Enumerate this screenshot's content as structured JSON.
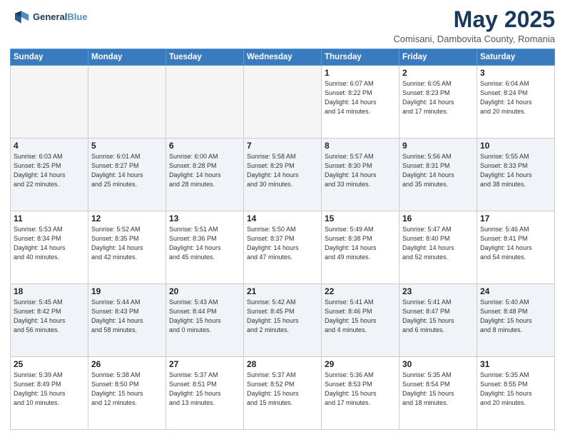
{
  "header": {
    "logo_line1": "General",
    "logo_line2": "Blue",
    "month": "May 2025",
    "location": "Comisani, Dambovita County, Romania"
  },
  "weekdays": [
    "Sunday",
    "Monday",
    "Tuesday",
    "Wednesday",
    "Thursday",
    "Friday",
    "Saturday"
  ],
  "weeks": [
    [
      {
        "day": "",
        "info": ""
      },
      {
        "day": "",
        "info": ""
      },
      {
        "day": "",
        "info": ""
      },
      {
        "day": "",
        "info": ""
      },
      {
        "day": "1",
        "info": "Sunrise: 6:07 AM\nSunset: 8:22 PM\nDaylight: 14 hours\nand 14 minutes."
      },
      {
        "day": "2",
        "info": "Sunrise: 6:05 AM\nSunset: 8:23 PM\nDaylight: 14 hours\nand 17 minutes."
      },
      {
        "day": "3",
        "info": "Sunrise: 6:04 AM\nSunset: 8:24 PM\nDaylight: 14 hours\nand 20 minutes."
      }
    ],
    [
      {
        "day": "4",
        "info": "Sunrise: 6:03 AM\nSunset: 8:25 PM\nDaylight: 14 hours\nand 22 minutes."
      },
      {
        "day": "5",
        "info": "Sunrise: 6:01 AM\nSunset: 8:27 PM\nDaylight: 14 hours\nand 25 minutes."
      },
      {
        "day": "6",
        "info": "Sunrise: 6:00 AM\nSunset: 8:28 PM\nDaylight: 14 hours\nand 28 minutes."
      },
      {
        "day": "7",
        "info": "Sunrise: 5:58 AM\nSunset: 8:29 PM\nDaylight: 14 hours\nand 30 minutes."
      },
      {
        "day": "8",
        "info": "Sunrise: 5:57 AM\nSunset: 8:30 PM\nDaylight: 14 hours\nand 33 minutes."
      },
      {
        "day": "9",
        "info": "Sunrise: 5:56 AM\nSunset: 8:31 PM\nDaylight: 14 hours\nand 35 minutes."
      },
      {
        "day": "10",
        "info": "Sunrise: 5:55 AM\nSunset: 8:33 PM\nDaylight: 14 hours\nand 38 minutes."
      }
    ],
    [
      {
        "day": "11",
        "info": "Sunrise: 5:53 AM\nSunset: 8:34 PM\nDaylight: 14 hours\nand 40 minutes."
      },
      {
        "day": "12",
        "info": "Sunrise: 5:52 AM\nSunset: 8:35 PM\nDaylight: 14 hours\nand 42 minutes."
      },
      {
        "day": "13",
        "info": "Sunrise: 5:51 AM\nSunset: 8:36 PM\nDaylight: 14 hours\nand 45 minutes."
      },
      {
        "day": "14",
        "info": "Sunrise: 5:50 AM\nSunset: 8:37 PM\nDaylight: 14 hours\nand 47 minutes."
      },
      {
        "day": "15",
        "info": "Sunrise: 5:49 AM\nSunset: 8:38 PM\nDaylight: 14 hours\nand 49 minutes."
      },
      {
        "day": "16",
        "info": "Sunrise: 5:47 AM\nSunset: 8:40 PM\nDaylight: 14 hours\nand 52 minutes."
      },
      {
        "day": "17",
        "info": "Sunrise: 5:46 AM\nSunset: 8:41 PM\nDaylight: 14 hours\nand 54 minutes."
      }
    ],
    [
      {
        "day": "18",
        "info": "Sunrise: 5:45 AM\nSunset: 8:42 PM\nDaylight: 14 hours\nand 56 minutes."
      },
      {
        "day": "19",
        "info": "Sunrise: 5:44 AM\nSunset: 8:43 PM\nDaylight: 14 hours\nand 58 minutes."
      },
      {
        "day": "20",
        "info": "Sunrise: 5:43 AM\nSunset: 8:44 PM\nDaylight: 15 hours\nand 0 minutes."
      },
      {
        "day": "21",
        "info": "Sunrise: 5:42 AM\nSunset: 8:45 PM\nDaylight: 15 hours\nand 2 minutes."
      },
      {
        "day": "22",
        "info": "Sunrise: 5:41 AM\nSunset: 8:46 PM\nDaylight: 15 hours\nand 4 minutes."
      },
      {
        "day": "23",
        "info": "Sunrise: 5:41 AM\nSunset: 8:47 PM\nDaylight: 15 hours\nand 6 minutes."
      },
      {
        "day": "24",
        "info": "Sunrise: 5:40 AM\nSunset: 8:48 PM\nDaylight: 15 hours\nand 8 minutes."
      }
    ],
    [
      {
        "day": "25",
        "info": "Sunrise: 5:39 AM\nSunset: 8:49 PM\nDaylight: 15 hours\nand 10 minutes."
      },
      {
        "day": "26",
        "info": "Sunrise: 5:38 AM\nSunset: 8:50 PM\nDaylight: 15 hours\nand 12 minutes."
      },
      {
        "day": "27",
        "info": "Sunrise: 5:37 AM\nSunset: 8:51 PM\nDaylight: 15 hours\nand 13 minutes."
      },
      {
        "day": "28",
        "info": "Sunrise: 5:37 AM\nSunset: 8:52 PM\nDaylight: 15 hours\nand 15 minutes."
      },
      {
        "day": "29",
        "info": "Sunrise: 5:36 AM\nSunset: 8:53 PM\nDaylight: 15 hours\nand 17 minutes."
      },
      {
        "day": "30",
        "info": "Sunrise: 5:35 AM\nSunset: 8:54 PM\nDaylight: 15 hours\nand 18 minutes."
      },
      {
        "day": "31",
        "info": "Sunrise: 5:35 AM\nSunset: 8:55 PM\nDaylight: 15 hours\nand 20 minutes."
      }
    ]
  ]
}
